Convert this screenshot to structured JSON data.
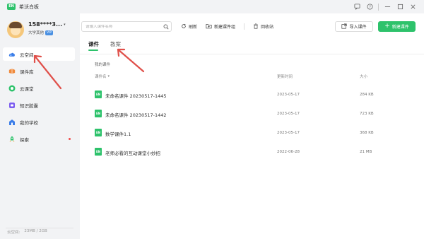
{
  "app": {
    "title": "希沃白板",
    "logo_text": "EN"
  },
  "titlebar": {
    "icons": [
      "feedback-icon",
      "help-icon",
      "minimize-icon",
      "maximize-icon",
      "close-icon"
    ]
  },
  "profile": {
    "name": "158****3...",
    "role": "大学其他",
    "badge": "VIP"
  },
  "sidebar": {
    "items": [
      {
        "label": "云空间",
        "icon": "cloud-icon",
        "active": true
      },
      {
        "label": "课件库",
        "icon": "library-icon",
        "active": false
      },
      {
        "label": "云课堂",
        "icon": "classroom-icon",
        "active": false
      },
      {
        "label": "知识胶囊",
        "icon": "capsule-icon",
        "active": false
      },
      {
        "label": "我的学校",
        "icon": "school-icon",
        "active": false
      },
      {
        "label": "探索",
        "icon": "rocket-icon",
        "active": false,
        "dot": true
      }
    ],
    "storage_label": "云空间:",
    "storage_value": "23MB / 2GB"
  },
  "search": {
    "placeholder": "请输入课件名称",
    "value": ""
  },
  "toolbar": {
    "refresh_label": "刷新",
    "new_group_label": "新建课件组",
    "recycle_label": "回收站",
    "import_label": "导入课件",
    "new_label": "新建课件"
  },
  "tabs": [
    {
      "label": "课件",
      "active": true
    },
    {
      "label": "教案",
      "active": false
    }
  ],
  "breadcrumb": "我的课件",
  "table": {
    "headers": {
      "name": "课件名",
      "date": "更新时间",
      "size": "大小"
    },
    "rows": [
      {
        "name": "未命名课件 20230517-1445",
        "date": "2023-05-17",
        "size": "284 KB"
      },
      {
        "name": "未命名课件 20230517-1442",
        "date": "2023-05-17",
        "size": "723 KB"
      },
      {
        "name": "数学课件1.1",
        "date": "2023-05-17",
        "size": "368 KB"
      },
      {
        "name": "老师必看的互动课堂小妙招",
        "date": "2022-06-28",
        "size": "21 MB"
      }
    ]
  },
  "colors": {
    "accent": "#2dc26b",
    "annotation": "#e0504a",
    "sidebar_bg": "#f2f3f5"
  }
}
